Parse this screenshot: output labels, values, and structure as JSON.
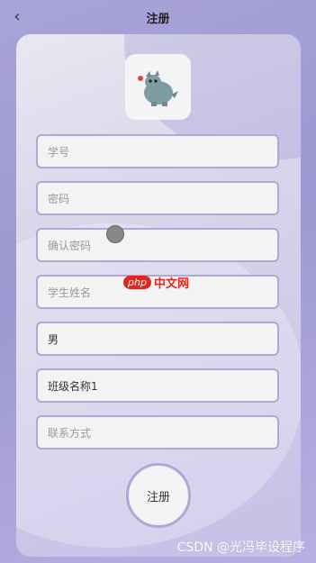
{
  "header": {
    "title": "注册"
  },
  "form": {
    "student_id_placeholder": "学号",
    "password_placeholder": "密码",
    "confirm_password_placeholder": "确认密码",
    "student_name_placeholder": "学生姓名",
    "gender_value": "男",
    "class_name_value": "班级名称1",
    "contact_placeholder": "联系方式"
  },
  "actions": {
    "register_label": "注册"
  },
  "watermarks": {
    "php_pill": "php",
    "php_cn": "中文网",
    "csdn": "CSDN @光冯毕设程序"
  }
}
